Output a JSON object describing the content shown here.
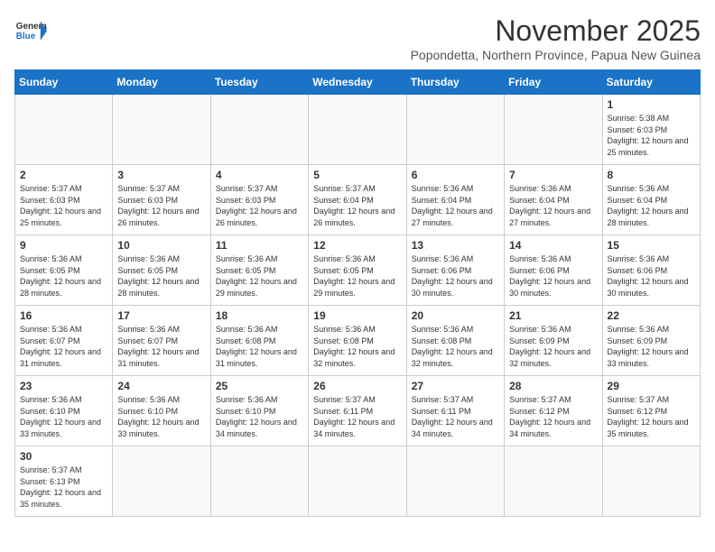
{
  "header": {
    "logo_general": "General",
    "logo_blue": "Blue",
    "month_title": "November 2025",
    "location": "Popondetta, Northern Province, Papua New Guinea"
  },
  "days_of_week": [
    "Sunday",
    "Monday",
    "Tuesday",
    "Wednesday",
    "Thursday",
    "Friday",
    "Saturday"
  ],
  "weeks": [
    [
      {
        "day": "",
        "info": ""
      },
      {
        "day": "",
        "info": ""
      },
      {
        "day": "",
        "info": ""
      },
      {
        "day": "",
        "info": ""
      },
      {
        "day": "",
        "info": ""
      },
      {
        "day": "",
        "info": ""
      },
      {
        "day": "1",
        "info": "Sunrise: 5:38 AM\nSunset: 6:03 PM\nDaylight: 12 hours and 25 minutes."
      }
    ],
    [
      {
        "day": "2",
        "info": "Sunrise: 5:37 AM\nSunset: 6:03 PM\nDaylight: 12 hours and 25 minutes."
      },
      {
        "day": "3",
        "info": "Sunrise: 5:37 AM\nSunset: 6:03 PM\nDaylight: 12 hours and 26 minutes."
      },
      {
        "day": "4",
        "info": "Sunrise: 5:37 AM\nSunset: 6:03 PM\nDaylight: 12 hours and 26 minutes."
      },
      {
        "day": "5",
        "info": "Sunrise: 5:37 AM\nSunset: 6:04 PM\nDaylight: 12 hours and 26 minutes."
      },
      {
        "day": "6",
        "info": "Sunrise: 5:36 AM\nSunset: 6:04 PM\nDaylight: 12 hours and 27 minutes."
      },
      {
        "day": "7",
        "info": "Sunrise: 5:36 AM\nSunset: 6:04 PM\nDaylight: 12 hours and 27 minutes."
      },
      {
        "day": "8",
        "info": "Sunrise: 5:36 AM\nSunset: 6:04 PM\nDaylight: 12 hours and 28 minutes."
      }
    ],
    [
      {
        "day": "9",
        "info": "Sunrise: 5:36 AM\nSunset: 6:05 PM\nDaylight: 12 hours and 28 minutes."
      },
      {
        "day": "10",
        "info": "Sunrise: 5:36 AM\nSunset: 6:05 PM\nDaylight: 12 hours and 28 minutes."
      },
      {
        "day": "11",
        "info": "Sunrise: 5:36 AM\nSunset: 6:05 PM\nDaylight: 12 hours and 29 minutes."
      },
      {
        "day": "12",
        "info": "Sunrise: 5:36 AM\nSunset: 6:05 PM\nDaylight: 12 hours and 29 minutes."
      },
      {
        "day": "13",
        "info": "Sunrise: 5:36 AM\nSunset: 6:06 PM\nDaylight: 12 hours and 30 minutes."
      },
      {
        "day": "14",
        "info": "Sunrise: 5:36 AM\nSunset: 6:06 PM\nDaylight: 12 hours and 30 minutes."
      },
      {
        "day": "15",
        "info": "Sunrise: 5:36 AM\nSunset: 6:06 PM\nDaylight: 12 hours and 30 minutes."
      }
    ],
    [
      {
        "day": "16",
        "info": "Sunrise: 5:36 AM\nSunset: 6:07 PM\nDaylight: 12 hours and 31 minutes."
      },
      {
        "day": "17",
        "info": "Sunrise: 5:36 AM\nSunset: 6:07 PM\nDaylight: 12 hours and 31 minutes."
      },
      {
        "day": "18",
        "info": "Sunrise: 5:36 AM\nSunset: 6:08 PM\nDaylight: 12 hours and 31 minutes."
      },
      {
        "day": "19",
        "info": "Sunrise: 5:36 AM\nSunset: 6:08 PM\nDaylight: 12 hours and 32 minutes."
      },
      {
        "day": "20",
        "info": "Sunrise: 5:36 AM\nSunset: 6:08 PM\nDaylight: 12 hours and 32 minutes."
      },
      {
        "day": "21",
        "info": "Sunrise: 5:36 AM\nSunset: 6:09 PM\nDaylight: 12 hours and 32 minutes."
      },
      {
        "day": "22",
        "info": "Sunrise: 5:36 AM\nSunset: 6:09 PM\nDaylight: 12 hours and 33 minutes."
      }
    ],
    [
      {
        "day": "23",
        "info": "Sunrise: 5:36 AM\nSunset: 6:10 PM\nDaylight: 12 hours and 33 minutes."
      },
      {
        "day": "24",
        "info": "Sunrise: 5:36 AM\nSunset: 6:10 PM\nDaylight: 12 hours and 33 minutes."
      },
      {
        "day": "25",
        "info": "Sunrise: 5:36 AM\nSunset: 6:10 PM\nDaylight: 12 hours and 34 minutes."
      },
      {
        "day": "26",
        "info": "Sunrise: 5:37 AM\nSunset: 6:11 PM\nDaylight: 12 hours and 34 minutes."
      },
      {
        "day": "27",
        "info": "Sunrise: 5:37 AM\nSunset: 6:11 PM\nDaylight: 12 hours and 34 minutes."
      },
      {
        "day": "28",
        "info": "Sunrise: 5:37 AM\nSunset: 6:12 PM\nDaylight: 12 hours and 34 minutes."
      },
      {
        "day": "29",
        "info": "Sunrise: 5:37 AM\nSunset: 6:12 PM\nDaylight: 12 hours and 35 minutes."
      }
    ],
    [
      {
        "day": "30",
        "info": "Sunrise: 5:37 AM\nSunset: 6:13 PM\nDaylight: 12 hours and 35 minutes."
      },
      {
        "day": "",
        "info": ""
      },
      {
        "day": "",
        "info": ""
      },
      {
        "day": "",
        "info": ""
      },
      {
        "day": "",
        "info": ""
      },
      {
        "day": "",
        "info": ""
      },
      {
        "day": "",
        "info": ""
      }
    ]
  ]
}
